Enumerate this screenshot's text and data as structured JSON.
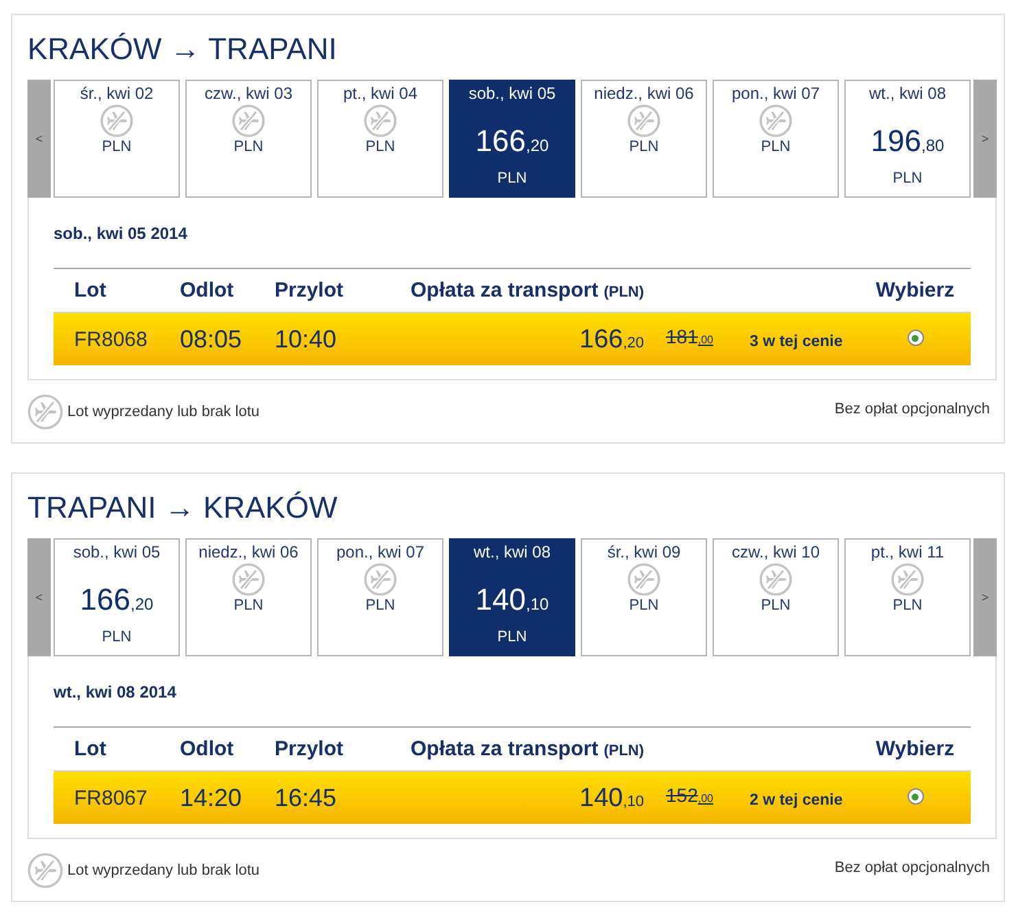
{
  "itineraries": [
    {
      "title": "KRAKÓW → TRAPANI",
      "prev_arrow": "<",
      "next_arrow": ">",
      "days": [
        {
          "label": "śr., kwi 02",
          "kind": "sold_out",
          "currency": "PLN",
          "selected": false
        },
        {
          "label": "czw., kwi 03",
          "kind": "sold_out",
          "currency": "PLN",
          "selected": false
        },
        {
          "label": "pt., kwi 04",
          "kind": "sold_out",
          "currency": "PLN",
          "selected": false
        },
        {
          "label": "sob., kwi 05",
          "kind": "fare",
          "price": "166$_{,20}$",
          "currency": "PLN",
          "selected": true
        },
        {
          "label": "niedz., kwi 06",
          "kind": "sold_out",
          "currency": "PLN",
          "selected": false
        },
        {
          "label": "pon., kwi 07",
          "kind": "sold_out",
          "currency": "PLN",
          "selected": false
        },
        {
          "label": "wt., kwi 08",
          "kind": "fare",
          "price": "196$_{,80}$",
          "currency": "PLN",
          "selected": false
        }
      ],
      "date_heading": "sob., kwi 05 2014",
      "columns": [
        {
          "label": "Lot"
        },
        {
          "label": "Odlot"
        },
        {
          "label": "Przylot"
        },
        {
          "label": "Opłata za transport",
          "unit": "(PLN)"
        },
        {
          "label": "Wybierz"
        }
      ],
      "flights": [
        {
          "flight": "FR8068",
          "departure": "08:05",
          "arrival": "10:40",
          "price": "166$_{,20}$",
          "old_price": "181$_{,00}$",
          "availability": "3 w tej cenie",
          "selected": true
        }
      ],
      "legend": "Lot wyprzedany lub brak lotu",
      "fees_note": "Bez opłat opcjonalnych"
    },
    {
      "title": "TRAPANI → KRAKÓW",
      "prev_arrow": "<",
      "next_arrow": ">",
      "days": [
        {
          "label": "sob., kwi 05",
          "kind": "fare",
          "price": "166$_{,20}$",
          "currency": "PLN",
          "selected": false
        },
        {
          "label": "niedz., kwi 06",
          "kind": "sold_out",
          "currency": "PLN",
          "selected": false
        },
        {
          "label": "pon., kwi 07",
          "kind": "sold_out",
          "currency": "PLN",
          "selected": false
        },
        {
          "label": "wt., kwi 08",
          "kind": "fare",
          "price": "140$_{,10}$",
          "currency": "PLN",
          "selected": true
        },
        {
          "label": "śr., kwi 09",
          "kind": "sold_out",
          "currency": "PLN",
          "selected": false
        },
        {
          "label": "czw., kwi 10",
          "kind": "sold_out",
          "currency": "PLN",
          "selected": false
        },
        {
          "label": "pt., kwi 11",
          "kind": "sold_out",
          "currency": "PLN",
          "selected": false
        }
      ],
      "date_heading": "wt., kwi 08 2014",
      "columns": [
        {
          "label": "Lot"
        },
        {
          "label": "Odlot"
        },
        {
          "label": "Przylot"
        },
        {
          "label": "Opłata za transport",
          "unit": "(PLN)"
        },
        {
          "label": "Wybierz"
        }
      ],
      "flights": [
        {
          "flight": "FR8067",
          "departure": "14:20",
          "arrival": "16:45",
          "price": "140$_{,10}$",
          "old_price": "152$_{,00}$",
          "availability": "2 w tej cenie",
          "selected": true
        }
      ],
      "legend": "Lot wyprzedany lub brak lotu",
      "fees_note": "Bez opłat opcjonalnych"
    }
  ]
}
